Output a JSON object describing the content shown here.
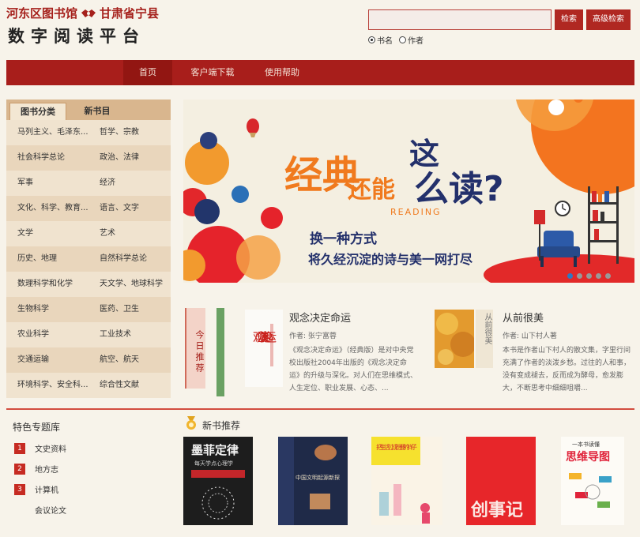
{
  "header": {
    "library_name": "河东区图书馆",
    "county_name": "甘肃省宁县",
    "platform_title": "数字阅读平台"
  },
  "search": {
    "placeholder": "",
    "search_button": "检索",
    "advanced_button": "高级检索",
    "options": [
      {
        "label": "书名",
        "selected": true
      },
      {
        "label": "作者",
        "selected": false
      }
    ]
  },
  "nav": {
    "items": [
      {
        "label": "首页",
        "active": true
      },
      {
        "label": "客户端下载",
        "active": false
      },
      {
        "label": "使用帮助",
        "active": false
      }
    ]
  },
  "category_tabs": [
    {
      "label": "图书分类",
      "active": true
    },
    {
      "label": "新书目",
      "active": false
    }
  ],
  "categories": [
    [
      "马列主义、毛泽东...",
      "哲学、宗教"
    ],
    [
      "社会科学总论",
      "政治、法律"
    ],
    [
      "军事",
      "经济"
    ],
    [
      "文化、科学、教育...",
      "语言、文字"
    ],
    [
      "文学",
      "艺术"
    ],
    [
      "历史、地理",
      "自然科学总论"
    ],
    [
      "数理科学和化学",
      "天文学、地球科学"
    ],
    [
      "生物科学",
      "医药、卫生"
    ],
    [
      "农业科学",
      "工业技术"
    ],
    [
      "交通运输",
      "航空、航天"
    ],
    [
      "环境科学、安全科...",
      "综合性文献"
    ]
  ],
  "banner": {
    "headline_1": "经典",
    "headline_2": "这",
    "headline_3": "还能",
    "headline_4": "么读?",
    "reading_word": "READING",
    "tagline_1": "换一种方式",
    "tagline_2": "将久经沉淀的诗与美一网打尽",
    "slide_count": 5,
    "active_slide": 0
  },
  "today_recommend": {
    "tag": "今日推荐",
    "books": [
      {
        "title": "观念决定命运",
        "author": "作者: 张宁富蓉",
        "cover_text": "观念决定命运",
        "description": "《观念决定命运》（经典版）是对中央党校出版社2004年出版的《观念决定命运》的升级与深化。对人们在思维模式、人生定位、职业发展、心态、..."
      },
      {
        "title": "从前很美",
        "author": "作者: 山下村人著",
        "cover_text": "从前很美",
        "description": "本书是作者山下村人的散文集，字里行间充满了作者的淡泼乡愁。过往的人和事，没有变成褪去，反而成为酵母，愈发膨大，不断思考中细细咀嚼..."
      }
    ]
  },
  "special_topics": {
    "title": "特色专题库",
    "items": [
      {
        "num": "1",
        "label": "文史资料"
      },
      {
        "num": "2",
        "label": "地方志"
      },
      {
        "num": "3",
        "label": "计算机"
      },
      {
        "num": "",
        "label": "会议论文"
      }
    ]
  },
  "new_books": {
    "title": "新书推荐",
    "books": [
      {
        "title": "墨菲定律",
        "subtitle": "每天学点心理学"
      },
      {
        "title": "中国文明起源新探",
        "subtitle": ""
      },
      {
        "title": "把生活过成想要的样子",
        "subtitle": ""
      },
      {
        "title": "创事记",
        "subtitle": ""
      },
      {
        "title": "思维导图",
        "subtitle": "一本书读懂"
      }
    ]
  },
  "colors": {
    "brand_red": "#a81e1b",
    "accent_orange": "#f07a1e",
    "bg": "#f7f3ea"
  }
}
